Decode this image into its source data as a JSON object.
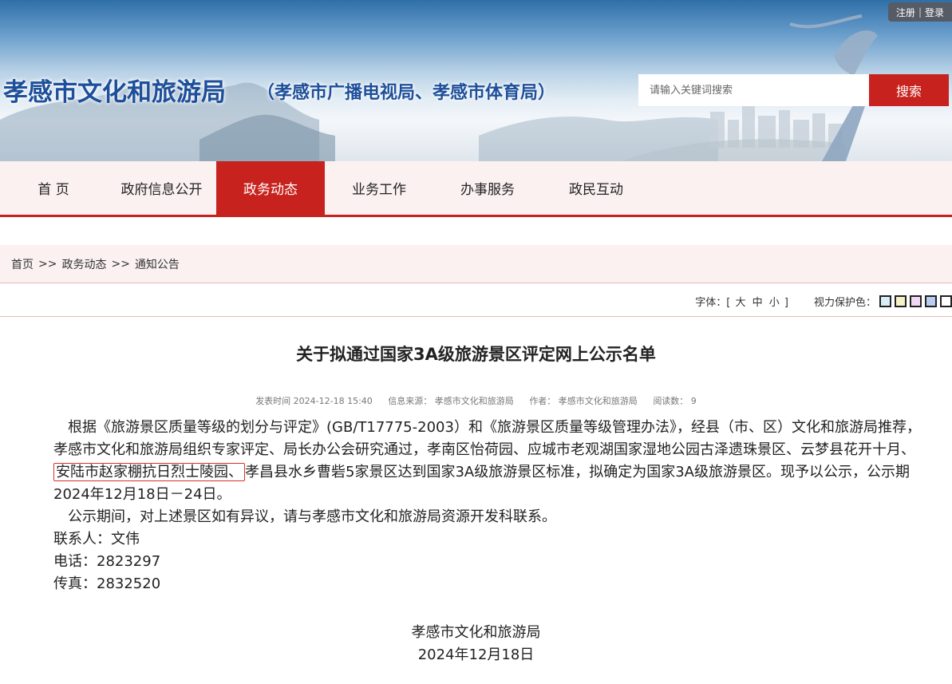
{
  "header": {
    "title": "孝感市文化和旅游局",
    "subtitle": "（孝感市广播电视局、孝感市体育局）",
    "register": "注册",
    "login": "登录",
    "search_placeholder": "请输入关键词搜索",
    "search_button": "搜索"
  },
  "nav": [
    {
      "label": "首  页",
      "active": false
    },
    {
      "label": "政府信息公开",
      "active": false
    },
    {
      "label": "政务动态",
      "active": true
    },
    {
      "label": "业务工作",
      "active": false
    },
    {
      "label": "办事服务",
      "active": false
    },
    {
      "label": "政民互动",
      "active": false
    }
  ],
  "breadcrumb": {
    "home": "首页",
    "sep": ">>",
    "level1": "政务动态",
    "level2": "通知公告"
  },
  "tools": {
    "font_label": "字体：",
    "bracket_open": "[",
    "large": "大",
    "medium": "中",
    "small": "小",
    "bracket_close": "]",
    "eye_label": "视力保护色：",
    "swatches": [
      "#d7eef6",
      "#f7f1c8",
      "#f1d7f1",
      "#b9cdf0",
      "#ffffff"
    ]
  },
  "article": {
    "title": "关于拟通过国家3A级旅游景区评定网上公示名单",
    "publish_time": "发表时间 2024-12-18 15:40",
    "source": "信息来源： 孝感市文化和旅游局",
    "author": "作者： 孝感市文化和旅游局",
    "reads": "阅读数： 9",
    "p1_before": "根据《旅游景区质量等级的划分与评定》(GB/T17775-2003）和《旅游景区质量等级管理办法》，经县（市、区）文化和旅游局推荐，孝感市文化和旅游局组织专家评定、局长办公会研究通过，孝南区怡荷园、应城市老观湖国家湿地公园古泽遗珠景区、云梦县花开十月、",
    "p1_highlight": "安陆市赵家棚抗日烈士陵园、",
    "p1_after": "孝昌县水乡曹砦5家景区达到国家3A级旅游景区标准，拟确定为国家3A级旅游景区。现予以公示，公示期2024年12月18日－24日。",
    "p2": "公示期间，对上述景区如有异议，请与孝感市文化和旅游局资源开发科联系。",
    "contact": "联系人：文伟",
    "phone": "电话：2823297",
    "fax": "传真：2832520",
    "sign_org": "孝感市文化和旅游局",
    "sign_date": "2024年12月18日"
  }
}
